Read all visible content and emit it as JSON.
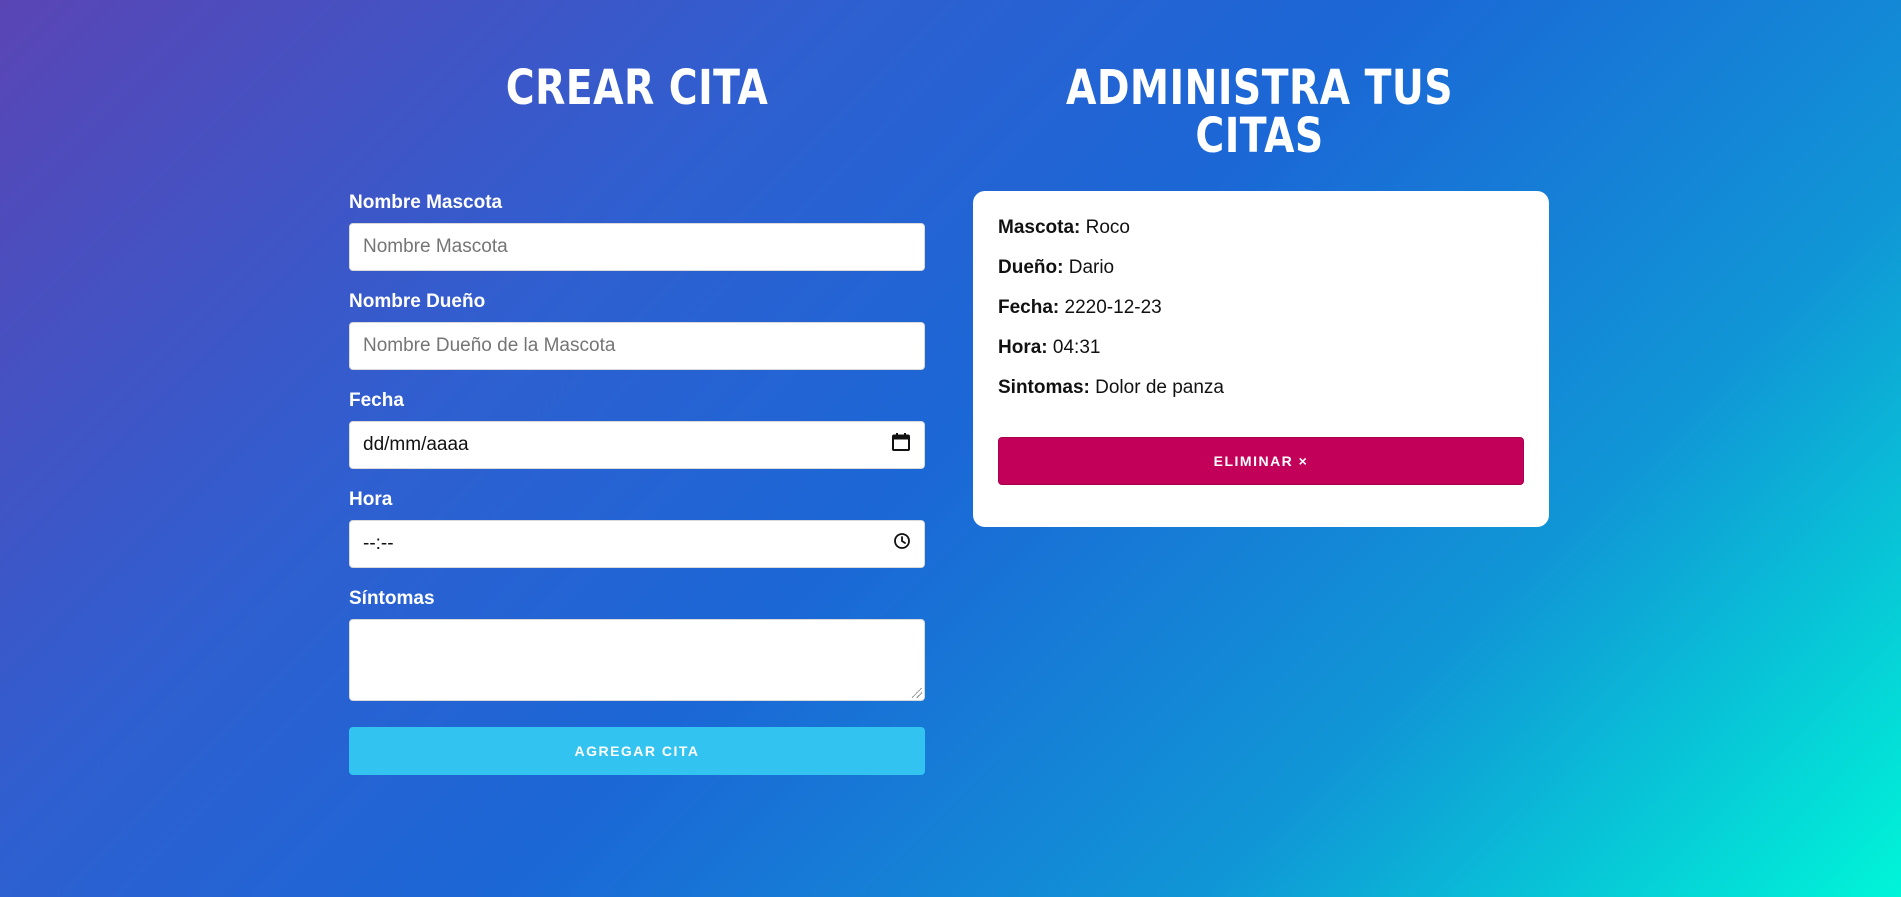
{
  "headings": {
    "create": "CREAR CITA",
    "manage": "ADMINISTRA TUS CITAS"
  },
  "form": {
    "pet_label": "Nombre Mascota",
    "pet_placeholder": "Nombre Mascota",
    "owner_label": "Nombre Dueño",
    "owner_placeholder": "Nombre Dueño de la Mascota",
    "date_label": "Fecha",
    "date_value": "dd/mm/aaaa",
    "time_label": "Hora",
    "time_value": "--:--",
    "symptoms_label": "Síntomas",
    "symptoms_value": "",
    "submit_label": "AGREGAR CITA",
    "icons": {
      "date": "calendar-icon",
      "time": "clock-icon"
    }
  },
  "appointment": {
    "pet_key": "Mascota:",
    "pet_value": "Roco",
    "owner_key": "Dueño:",
    "owner_value": "Dario",
    "date_key": "Fecha:",
    "date_value": "2220-12-23",
    "time_key": "Hora:",
    "time_value": "04:31",
    "symptoms_key": "Sintomas:",
    "symptoms_value": "Dolor de panza",
    "delete_label": "ELIMINAR ×"
  },
  "colors": {
    "submit_button": "#33c3f0",
    "delete_button": "#c2005a",
    "gradient_start": "#5a45b5",
    "gradient_end": "#00f5d8"
  }
}
